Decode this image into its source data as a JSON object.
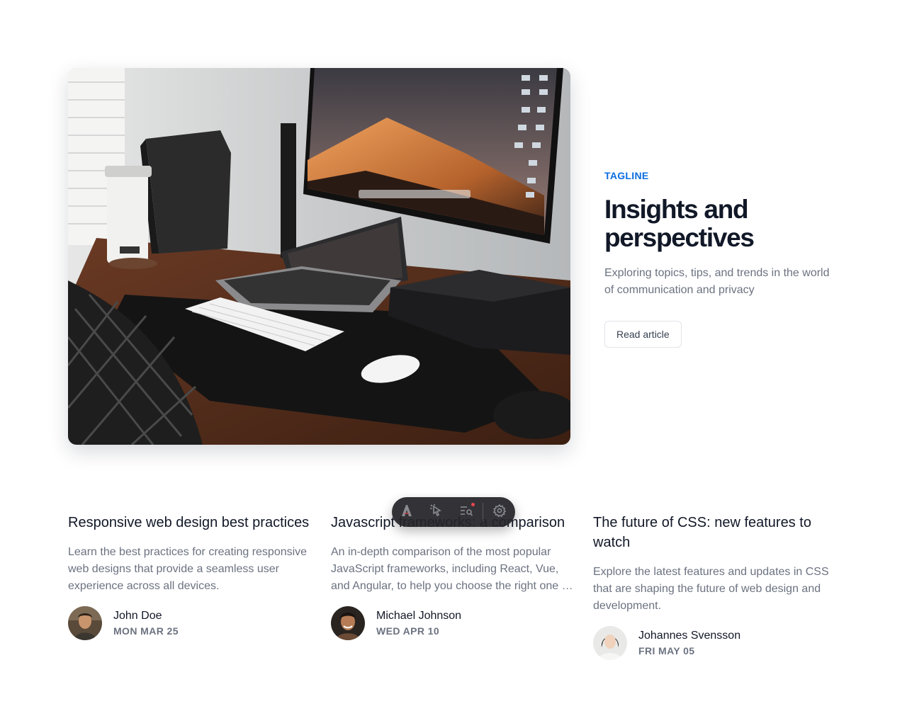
{
  "hero": {
    "image_alt": "Desk setup with monitor, laptop, keyboard and speakers",
    "tagline": "TAGLINE",
    "title": "Insights and perspectives",
    "description": "Exploring topics, tips, and trends in the world of communication and privacy",
    "button_label": "Read article"
  },
  "articles": [
    {
      "title": "Responsive web design best practices",
      "description": "Learn the best practices for creating responsive web designs that provide a seamless user experience across all devices.",
      "author": "John Doe",
      "date": "MON MAR 25"
    },
    {
      "title": "Javascript frameworks: a comparison",
      "description": "An in-depth comparison of the most popular JavaScript frameworks, including React, Vue, and Angular, to help you choose the right one for your project.",
      "author": "Michael Johnson",
      "date": "WED APR 10"
    },
    {
      "title": "The future of CSS: new features to watch",
      "description": "Explore the latest features and updates in CSS that are shaping the future of web design and development.",
      "author": "Johannes Svensson",
      "date": "FRI MAY 05"
    }
  ],
  "toolbar": {
    "items": [
      "astro-logo-icon",
      "cursor-inspect-icon",
      "audit-search-icon",
      "settings-gear-icon"
    ],
    "notification_dot_color": "#e5484d"
  },
  "colors": {
    "accent": "#0a6cdf",
    "text_primary": "#111827",
    "text_secondary": "#6b7280",
    "button_border": "#e1e3e8",
    "toolbar_bg": "#242428"
  }
}
